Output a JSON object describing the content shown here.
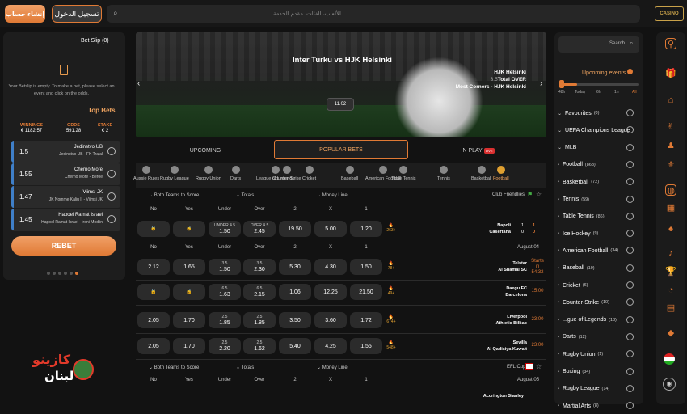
{
  "header": {
    "register": "إنشاء حساب",
    "login": "تسجيل الدخول",
    "search_placeholder": "الألعاب، الفئات، مقدم الخدمة",
    "logo": "CASINO"
  },
  "betslip": {
    "title": "Bet Slip (0)",
    "empty": "Your Betslip is empty. To make a bet, please select an event and click on the odds.",
    "topbets": "Top Bets",
    "winnings_label": "WINNINGS",
    "winnings": "€ 1182.57",
    "odds_label": "ODDS",
    "odds": "591.28",
    "stake_label": "STAKE",
    "stake": "€ 2",
    "rows": [
      {
        "odd": "1.5",
        "t1": "Jedinstvo UB",
        "t2": "Jedinstvo UB - FK Trajal"
      },
      {
        "odd": "1.55",
        "t1": "Cherno More",
        "t2": "Cherno More - Beroe"
      },
      {
        "odd": "1.47",
        "t1": "Viimsi JK",
        "t2": "JK Nomme Kalju II - Viimsi JK"
      },
      {
        "odd": "1.45",
        "t1": "Hapoel Ramat Israel",
        "t2": "Hapoel Ramat Israel - Ironi Modiin"
      }
    ],
    "rebet": "REBET"
  },
  "brand": {
    "line1": "كازينو",
    "line2": "لبنان"
  },
  "banner": {
    "title": "Inter Turku  vs  HJK Helsinki",
    "lines": [
      {
        "o": "",
        "t": "HJK Helsinki"
      },
      {
        "o": "3.5",
        "t": "Total OVER"
      },
      {
        "o": "",
        "t": "Most Corners - HJK Helsinki"
      }
    ],
    "odd": "11.02"
  },
  "tabs": {
    "upcoming": "UPCOMING",
    "popular": "POPULAR BETS",
    "inplay": "IN PLAY",
    "live": "LIVE"
  },
  "sports": [
    "Aussie Rules",
    "Rugby League",
    "Rugby Union",
    "Darts",
    "League of Legends",
    "Counter-Strike",
    "Cricket",
    "Baseball",
    "American Football",
    "Table Tennis",
    "Tennis",
    "Basketball",
    "Football"
  ],
  "markets": {
    "m1": "Both Teams to Score",
    "m2": "Totals",
    "m3": "Money Line",
    "no": "No",
    "yes": "Yes",
    "under": "Under",
    "over": "Over",
    "c2": "2",
    "cx": "X",
    "c1": "1"
  },
  "league1": "Club Friendlies",
  "league2": "EFL Cup",
  "match0": {
    "u": "UNDER 4.5",
    "uv": "1.50",
    "o": "OVER 4.5",
    "ov": "2.45",
    "v2": "19.50",
    "vx": "5.00",
    "v1": "1.20",
    "fire": "263+",
    "h": "Napoli",
    "a": "Casertana",
    "s1": "1",
    "s2": "0",
    "s3": "1",
    "s4": "0"
  },
  "date1": "August 04",
  "matches": [
    {
      "no": "2.12",
      "yes": "1.65",
      "ul": "3.5",
      "uv": "1.50",
      "ol": "3.5",
      "ov": "2.30",
      "v2": "5.30",
      "vx": "4.30",
      "v1": "1.50",
      "fire": "78+",
      "h": "Telstar",
      "a": "Al Shamal SC",
      "time": "Starts in 54:32"
    },
    {
      "no": "",
      "yes": "",
      "ul": "6.5",
      "uv": "1.63",
      "ol": "6.5",
      "ov": "2.15",
      "v2": "1.06",
      "vx": "12.25",
      "v1": "21.50",
      "fire": "49+",
      "h": "Daegu FC",
      "a": "Barcelona",
      "time": "15:00"
    },
    {
      "no": "2.05",
      "yes": "1.70",
      "ul": "2.5",
      "uv": "1.85",
      "ol": "2.5",
      "ov": "1.85",
      "v2": "3.50",
      "vx": "3.60",
      "v1": "1.72",
      "fire": "674+",
      "h": "Liverpool",
      "a": "Athletic Bilbao",
      "time": "23:00"
    },
    {
      "no": "2.05",
      "yes": "1.70",
      "ul": "2.5",
      "uv": "2.20",
      "ol": "2.5",
      "ov": "1.62",
      "v2": "5.40",
      "vx": "4.25",
      "v1": "1.55",
      "fire": "548+",
      "h": "Sevilla",
      "a": "Al Qadisiya Kuwait",
      "time": "23:00"
    }
  ],
  "date2": "August 05",
  "team_next": "Accrington Stanley",
  "right": {
    "search": "Search",
    "upcoming": "Upcoming events",
    "slider": [
      "48h",
      "Today",
      "6h",
      "1h",
      "All"
    ],
    "items": [
      {
        "l": "Favourites",
        "c": "(0)"
      },
      {
        "l": "UEFA Champions League",
        "c": ""
      },
      {
        "l": "MLB",
        "c": ""
      },
      {
        "l": "Football",
        "c": "(868)"
      },
      {
        "l": "Basketball",
        "c": "(72)"
      },
      {
        "l": "Tennis",
        "c": "(59)"
      },
      {
        "l": "Table Tennis",
        "c": "(86)"
      },
      {
        "l": "Ice Hockey",
        "c": "(9)"
      },
      {
        "l": "American Football",
        "c": "(34)"
      },
      {
        "l": "Baseball",
        "c": "(19)"
      },
      {
        "l": "Cricket",
        "c": "(6)"
      },
      {
        "l": "Counter-Strike",
        "c": "(10)"
      },
      {
        "l": "...gue of Legends",
        "c": "(13)"
      },
      {
        "l": "Darts",
        "c": "(12)"
      },
      {
        "l": "Rugby Union",
        "c": "(1)"
      },
      {
        "l": "Boxing",
        "c": "(34)"
      },
      {
        "l": "Rugby League",
        "c": "(14)"
      },
      {
        "l": "Martial Arts",
        "c": "(8)"
      }
    ]
  }
}
